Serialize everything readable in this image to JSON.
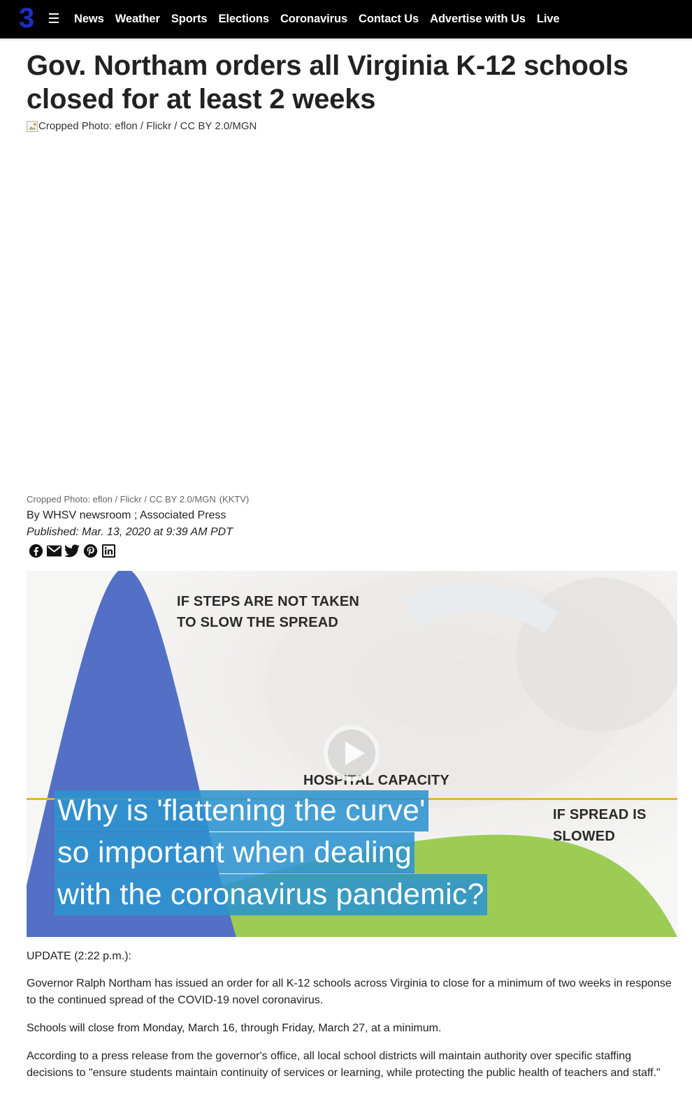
{
  "nav": {
    "logo": "3",
    "items": [
      "News",
      "Weather",
      "Sports",
      "Elections",
      "Coronavirus",
      "Contact Us",
      "Advertise with Us",
      "Live"
    ]
  },
  "article": {
    "headline": "Gov. Northam orders all Virginia K-12 schools closed for at least 2 weeks",
    "image_alt": "Cropped Photo: eflon / Flickr / CC BY 2.0/MGN",
    "caption": "Cropped Photo: eflon / Flickr / CC BY 2.0/MGN",
    "caption_source": "(KKTV)",
    "byline": "By WHSV newsroom ; Associated Press",
    "published": "Published: Mar. 13, 2020 at 9:39 AM PDT",
    "share_icons": [
      "facebook-icon",
      "email-icon",
      "twitter-icon",
      "pinterest-icon",
      "linkedin-icon"
    ]
  },
  "video": {
    "label_steps_1": "IF STEPS ARE NOT TAKEN",
    "label_steps_2": "TO SLOW THE SPREAD",
    "label_capacity": "HOSPITAL CAPACITY",
    "label_slowed_1": "IF SPREAD IS",
    "label_slowed_2": "SLOWED",
    "title_lines": [
      "Why is 'flattening the curve'",
      "so important when dealing",
      "with the coronavirus pandemic?"
    ],
    "colors": {
      "blue_curve": "#5470c6",
      "green_curve": "#9ccc54",
      "capacity_line": "#e3b62c",
      "title_bg": "#2c93cf"
    }
  },
  "body": {
    "update": "UPDATE (2:22 p.m.):",
    "p1": "Governor Ralph Northam has issued an order for all K-12 schools across Virginia to close for a minimum of two weeks in response to the continued spread of the COVID-19 novel coronavirus.",
    "p2": "Schools will close from Monday, March 16, through Friday, March 27, at a minimum.",
    "p3": "According to a press release from the governor's office, all local school districts will maintain authority over specific staffing decisions to \"ensure students maintain continuity of services or learning, while protecting the public health of teachers and staff.\""
  }
}
